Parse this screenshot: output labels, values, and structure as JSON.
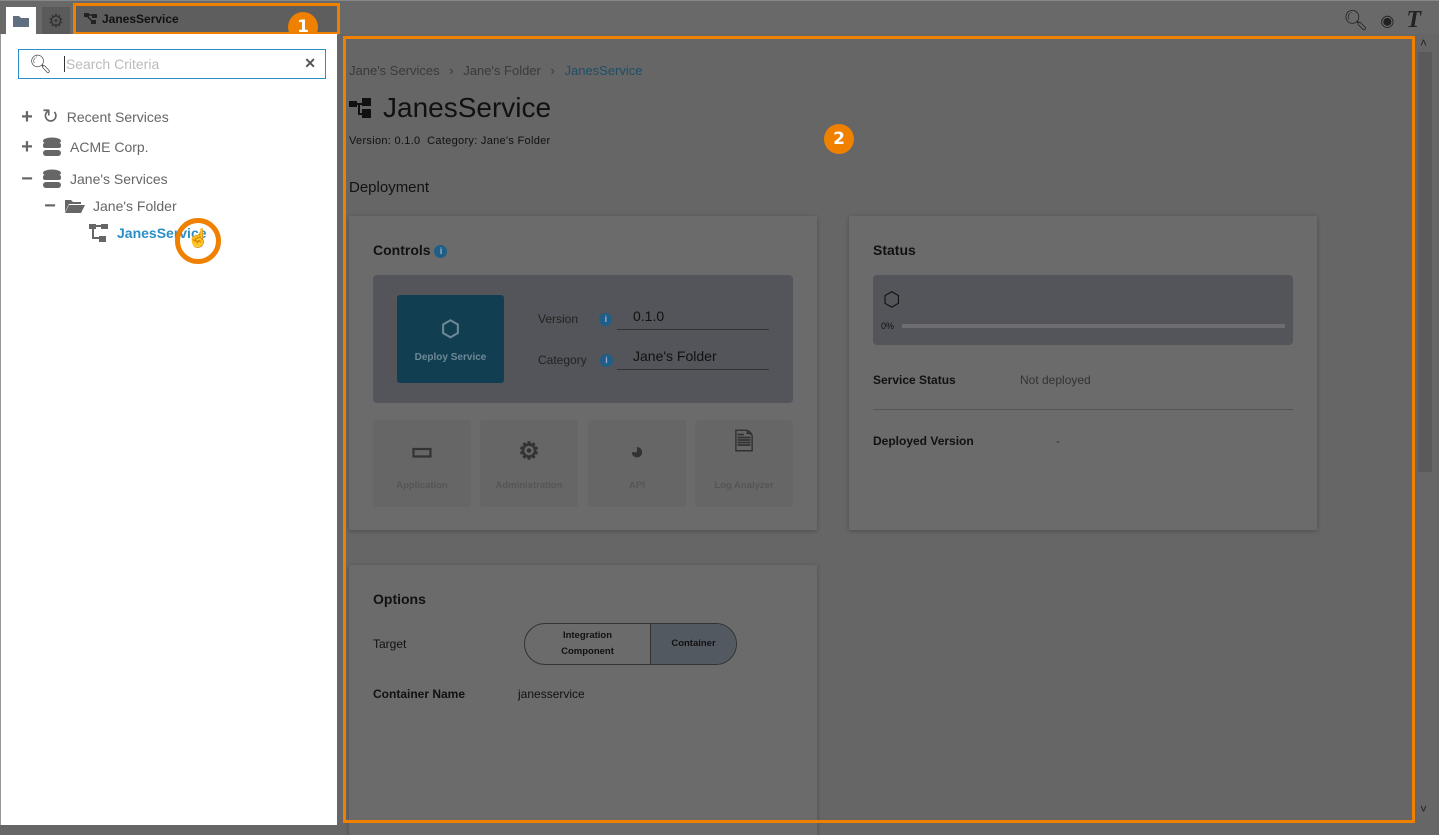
{
  "topbar": {
    "tabs": [
      {
        "icon": "folder-icon"
      },
      {
        "icon": "gear-icon"
      }
    ],
    "active_service": "JanesService",
    "icons": [
      "search-icon",
      "eye-icon",
      "text-format-icon"
    ],
    "badge1": "1"
  },
  "sidebar": {
    "search_placeholder": "Search Criteria",
    "tree": [
      {
        "label": "Recent Services",
        "expander": "+",
        "icon": "history-icon"
      },
      {
        "label": "ACME Corp.",
        "expander": "+",
        "icon": "database-icon"
      },
      {
        "label": "Jane's Services",
        "expander": "−",
        "icon": "database-icon"
      },
      {
        "label": "Jane's Folder",
        "expander": "−",
        "icon": "folder-open-icon"
      },
      {
        "label": "JanesService",
        "icon": "service-icon",
        "selected": true
      }
    ]
  },
  "main": {
    "badge2": "2",
    "breadcrumb": [
      "Jane's Services",
      "Jane's Folder",
      "JanesService"
    ],
    "breadcrumb_sep": "›",
    "title": "JanesService",
    "meta": "Version: 0.1.0  Category: Jane's Folder",
    "section": "Deployment",
    "controls": {
      "title": "Controls",
      "deploy_label": "Deploy Service",
      "version_label": "Version",
      "version_value": "0.1.0",
      "category_label": "Category",
      "category_value": "Jane's Folder",
      "tiles": [
        "Application",
        "Administration",
        "API",
        "Log Analyzer"
      ]
    },
    "status": {
      "title": "Status",
      "progress_label": "0%",
      "progress": 0,
      "service_status_label": "Service Status",
      "service_status_value": "Not deployed",
      "deployed_version_label": "Deployed Version",
      "deployed_version_value": "-"
    },
    "options": {
      "title": "Options",
      "target_label": "Target",
      "target_options": [
        "Integration Component",
        "Container"
      ],
      "target_selected": "Container",
      "container_name_label": "Container Name",
      "container_name_value": "janesservice"
    }
  },
  "colors": {
    "accent": "#f08000",
    "primary": "#2a8fc7",
    "deploy": "#123e52"
  }
}
